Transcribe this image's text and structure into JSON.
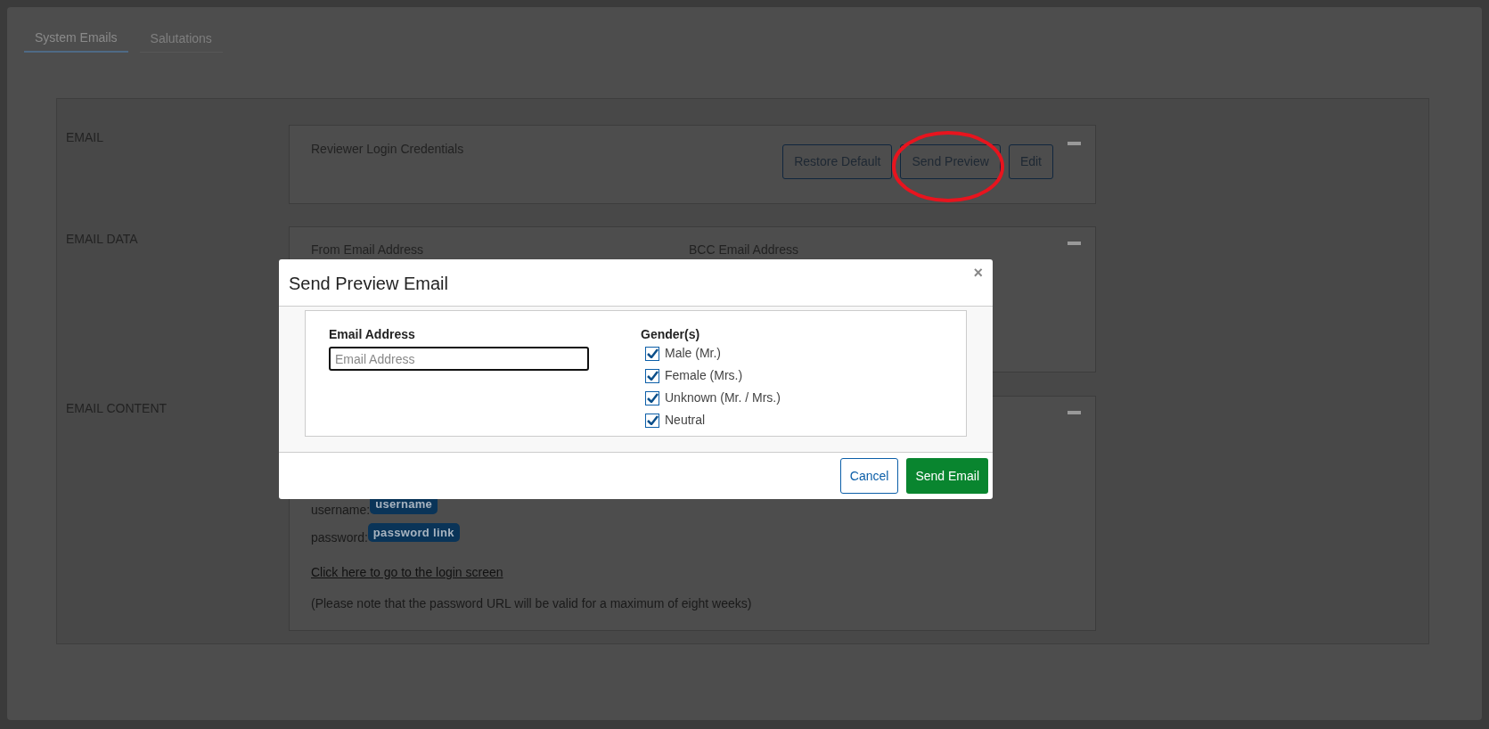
{
  "tabs": [
    {
      "label": "System Emails",
      "selected": true
    },
    {
      "label": "Salutations",
      "selected": false
    }
  ],
  "email": {
    "label": "EMAIL",
    "title": "Reviewer Login Credentials",
    "buttons": [
      "Restore Default",
      "Send Preview",
      "Edit"
    ]
  },
  "email_data": {
    "label": "EMAIL DATA",
    "fields": [
      "From Email Address",
      "BCC Email Address"
    ]
  },
  "email_content": {
    "label": "EMAIL CONTENT",
    "lines": [
      {
        "text": "username:",
        "badge": "username"
      },
      {
        "text": "password:",
        "badge": "password link"
      }
    ],
    "link": "Click here to go to the login screen",
    "note": "(Please note that the password URL will be valid for a maximum of eight weeks)"
  },
  "modal": {
    "title": "Send Preview Email",
    "close": "×",
    "email_label": "Email Address",
    "placeholder": "Email Address",
    "genders_label": "Gender(s)",
    "genders": [
      {
        "label": "Male (Mr.)",
        "checked": true
      },
      {
        "label": "Female (Mrs.)",
        "checked": true
      },
      {
        "label": "Unknown (Mr. / Mrs.)",
        "checked": true
      },
      {
        "label": "Neutral",
        "checked": true
      }
    ],
    "buttons": [
      {
        "label": "Cancel",
        "kind": "secondary"
      },
      {
        "label": "Send Email",
        "kind": "primary"
      }
    ]
  }
}
